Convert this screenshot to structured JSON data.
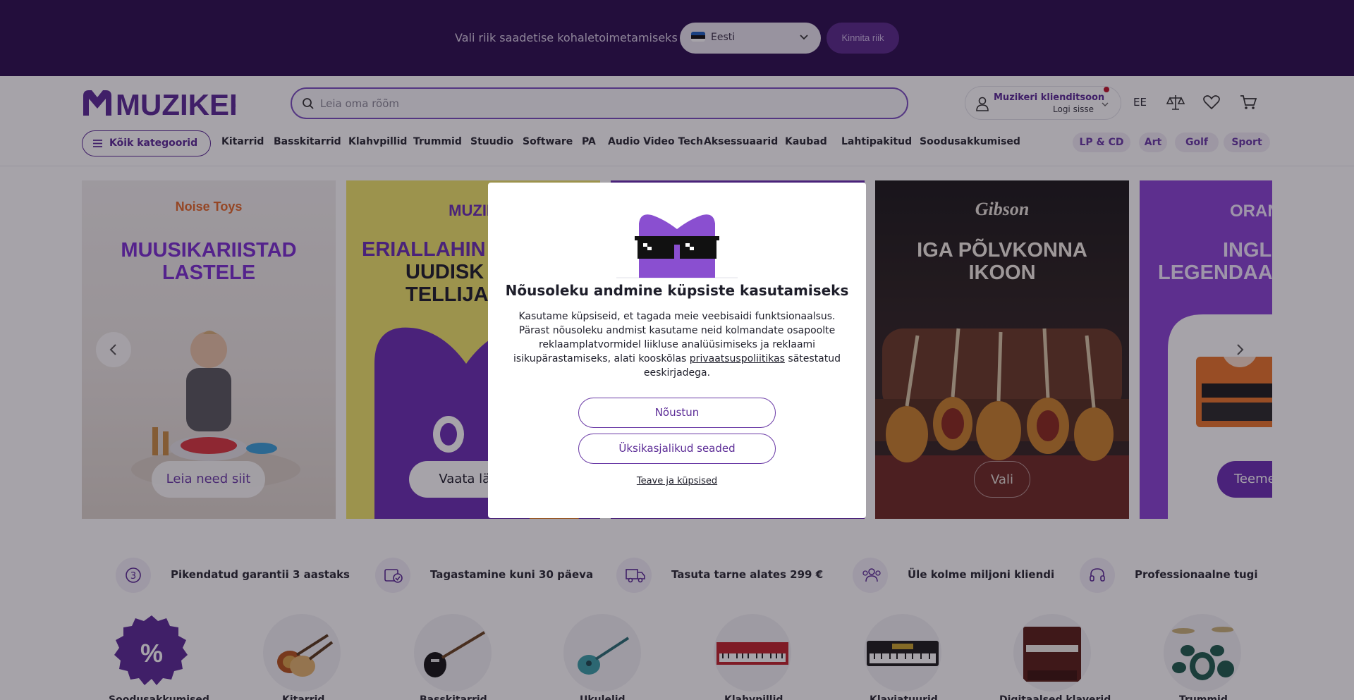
{
  "country_bar": {
    "label": "Vali riik saadetise kohaletoimetamiseks",
    "selected_country": "Eesti",
    "confirm_label": "Kinnita riik"
  },
  "header": {
    "logo_text": "MUZIKER",
    "search_placeholder": "Leia oma rõõm",
    "account_title": "Muzikeri klienditsoon",
    "account_subtitle": "Logi sisse",
    "language": "EE"
  },
  "nav": {
    "all_categories": "Kõik kategoorid",
    "items": [
      "Kitarrid",
      "Basskitarrid",
      "Klahvpillid",
      "Trummid",
      "Stuudio",
      "Software",
      "PA",
      "Audio Video Tech",
      "Aksessuaarid",
      "Kaubad",
      "Lahtipakitud",
      "Soodusakkumised"
    ],
    "pills": [
      "LP & CD",
      "Art",
      "Golf",
      "Sport"
    ]
  },
  "banners": [
    {
      "brand": "Noise Toys",
      "title_line1": "MUUSIKARIISTAD",
      "title_line2": "LASTELE",
      "button": "Leia need siit"
    },
    {
      "brand": "MUZIK",
      "title_line1": "ERIALLAHIN",
      "title_line2": "UUDISK",
      "title_line3": "TELLIJA",
      "button": "Vaata lähe"
    },
    {
      "brand": "Gibson",
      "title_line1": "IGA PÕLVKONNA",
      "title_line2": "IKOON",
      "button": "Vali"
    },
    {
      "brand": "ORAN",
      "title_line1": "INGLIS",
      "title_line2": "LEGENDAA",
      "button": "Teeme"
    }
  ],
  "cookie_modal": {
    "title": "Nõusoleku andmine küpsiste kasutamiseks",
    "text_before_link": "Kasutame küpsiseid, et tagada meie veebisaidi funktsionaalsus. Pärast nõusoleku andmist kasutame neid kolmandate osapoolte reklaamplatvormidel liikluse analüüsimiseks ja reklaami isikupärastamiseks, alati kooskõlas ",
    "link_text": "privaatsuspoliitikas",
    "text_after_link": " sätestatud eeskirjadega.",
    "accept_label": "Nõustun",
    "settings_label": "Üksikasjalikud seaded",
    "more_label": "Teave ja küpsised"
  },
  "features": [
    {
      "icon": "warranty-icon",
      "label": "Pikendatud garantii 3 aastaks"
    },
    {
      "icon": "return-icon",
      "label": "Tagastamine kuni 30 päeva"
    },
    {
      "icon": "truck-icon",
      "label": "Tasuta tarne alates 299 €"
    },
    {
      "icon": "customers-icon",
      "label": "Üle kolme miljoni kliendi"
    },
    {
      "icon": "headset-icon",
      "label": "Professionaalne tugi"
    }
  ],
  "categories": [
    {
      "icon": "sale-icon",
      "label": "Soodusakkumised"
    },
    {
      "icon": "guitar-icon",
      "label": "Kitarrid"
    },
    {
      "icon": "bass-guitar-icon",
      "label": "Basskitarrid"
    },
    {
      "icon": "ukulele-icon",
      "label": "Ukulelid"
    },
    {
      "icon": "stage-piano-icon",
      "label": "Klahvpillid"
    },
    {
      "icon": "keyboard-icon",
      "label": "Klaviatuurid"
    },
    {
      "icon": "digital-piano-icon",
      "label": "Digitaalsed klaverid"
    },
    {
      "icon": "drum-kit-icon",
      "label": "Trummid"
    }
  ],
  "colors": {
    "brand_purple": "#5b2b96",
    "country_bar_bg": "#2d0f4f",
    "accent_purple": "#8a44d4"
  }
}
